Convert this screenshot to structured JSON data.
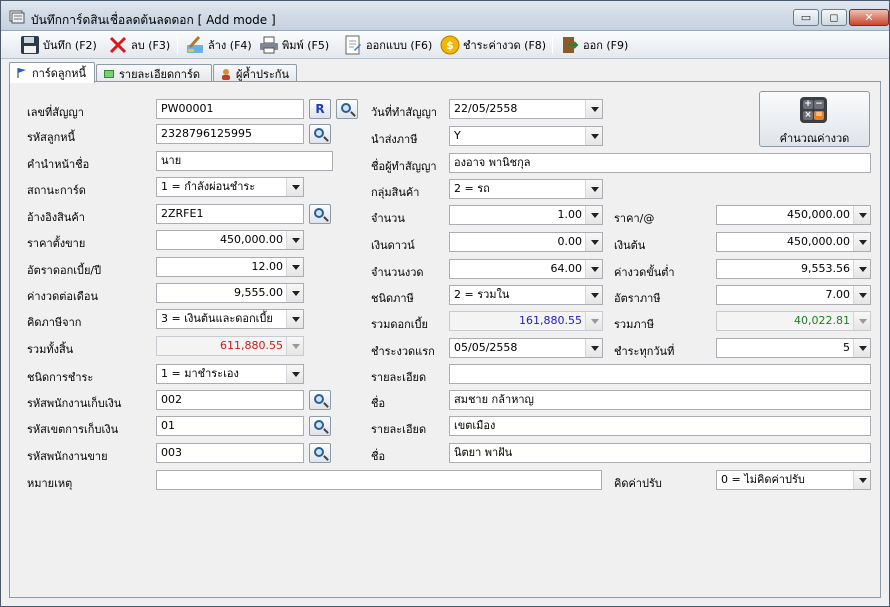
{
  "window": {
    "title": "บันทึกการ์ดสินเชื่อลดต้นลดดอก [ Add mode ]",
    "controls": {
      "minimize": "▭",
      "maximize": "◻",
      "close": "✕"
    }
  },
  "toolbar": {
    "save": "บันทึก (F2)",
    "delete": "ลบ (F3)",
    "clear": "ล้าง (F4)",
    "print": "พิมพ์ (F5)",
    "design": "ออกแบบ (F6)",
    "pay_installment": "ชำระค่างวด (F8)",
    "exit": "ออก (F9)"
  },
  "tabs": [
    {
      "label": "การ์ดลูกหนี้",
      "icon": "flag-icon",
      "active": true
    },
    {
      "label": "รายละเอียดการ์ด",
      "icon": "book-icon",
      "active": false
    },
    {
      "label": "ผู้ค้ำประกัน",
      "icon": "person-icon",
      "active": false
    }
  ],
  "form": {
    "contract_no": {
      "label": "เลขที่สัญญา",
      "value": "PW00001",
      "r_button": "R"
    },
    "debtor_code": {
      "label": "รหัสลูกหนี้",
      "value": "2328796125995"
    },
    "title_prefix": {
      "label": "คำนำหน้าชื่อ",
      "value": "นาย"
    },
    "card_status": {
      "label": "สถานะการ์ด",
      "value": "1 = กำลังผ่อนชำระ"
    },
    "product_ref": {
      "label": "อ้างอิงสินค้า",
      "value": "2ZRFE1"
    },
    "sale_price": {
      "label": "ราคาตั้งขาย",
      "value": "450,000.00"
    },
    "interest_rate": {
      "label": "อัตราดอกเบี้ย/ปี",
      "value": "12.00"
    },
    "monthly_installment": {
      "label": "ค่างวดต่อเดือน",
      "value": "9,555.00"
    },
    "tax_calc_from": {
      "label": "คิดภาษีจาก",
      "value": "3 = เงินต้นและดอกเบี้ย"
    },
    "grand_total": {
      "label": "รวมทั้งสิ้น",
      "value": "611,880.55"
    },
    "payment_type": {
      "label": "ชนิดการชำระ",
      "value": "1 = มาชำระเอง"
    },
    "collector_code": {
      "label": "รหัสพนักงานเก็บเงิน",
      "value": "002"
    },
    "collection_zone": {
      "label": "รหัสเขตการเก็บเงิน",
      "value": "01"
    },
    "sales_code": {
      "label": "รหัสพนักงานขาย",
      "value": "003"
    },
    "remark": {
      "label": "หมายเหตุ",
      "value": ""
    },
    "contract_date": {
      "label": "วันที่ทำสัญญา",
      "value": "22/05/2558"
    },
    "tax_submit": {
      "label": "นำส่งภาษี",
      "value": "Y"
    },
    "contractor_name": {
      "label": "ชื่อผู้ทำสัญญา",
      "value": "องอาจ พานิชกุล"
    },
    "product_group": {
      "label": "กลุ่มสินค้า",
      "value": "2 = รถ"
    },
    "quantity": {
      "label": "จำนวน",
      "value": "1.00"
    },
    "down_payment": {
      "label": "เงินดาวน์",
      "value": "0.00"
    },
    "num_installments": {
      "label": "จำนวนงวด",
      "value": "64.00"
    },
    "tax_type": {
      "label": "ชนิดภาษี",
      "value": "2 = รวมใน"
    },
    "total_interest": {
      "label": "รวมดอกเบี้ย",
      "value": "161,880.55"
    },
    "first_due": {
      "label": "ชำระงวดแรก",
      "value": "05/05/2558"
    },
    "detail_1": {
      "label": "รายละเอียด",
      "value": ""
    },
    "collector_name": {
      "label": "ชื่อ",
      "value": "สมชาย กล้าหาญ"
    },
    "zone_detail": {
      "label": "รายละเอียด",
      "value": "เขตเมือง"
    },
    "sales_name": {
      "label": "ชื่อ",
      "value": "นิตยา พาฝัน"
    },
    "unit_price": {
      "label": "ราคา/@",
      "value": "450,000.00"
    },
    "principal": {
      "label": "เงินต้น",
      "value": "450,000.00"
    },
    "min_installment": {
      "label": "ค่างวดขั้นต่ำ",
      "value": "9,553.56"
    },
    "tax_rate": {
      "label": "อัตราภาษี",
      "value": "7.00"
    },
    "total_tax": {
      "label": "รวมภาษี",
      "value": "40,022.81"
    },
    "pay_every_day": {
      "label": "ชำระทุกวันที่",
      "value": "5"
    },
    "penalty": {
      "label": "คิดค่าปรับ",
      "value": "0 = ไม่คิดค่าปรับ"
    }
  },
  "calc_button": {
    "label": "คำนวณค่างวด"
  },
  "colors": {
    "grand_total": "#d01818",
    "total_interest": "#2020c0",
    "total_tax": "#208020"
  }
}
